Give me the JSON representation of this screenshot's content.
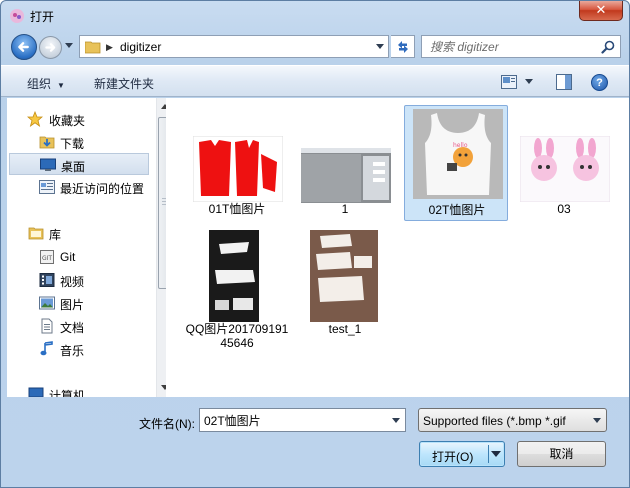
{
  "window": {
    "title": "打开",
    "close_glyph": "✕"
  },
  "nav": {
    "address_path": "digitizer",
    "address_separator": "▶",
    "search_placeholder": "搜索 digitizer"
  },
  "toolbar": {
    "organize_label": "组织",
    "new_folder_label": "新建文件夹",
    "help_glyph": "?"
  },
  "sidebar": {
    "items": [
      {
        "label": "收藏夹",
        "icon": "star-icon"
      },
      {
        "label": "下载",
        "icon": "download-folder-icon"
      },
      {
        "label": "桌面",
        "icon": "desktop-icon",
        "selected": true
      },
      {
        "label": "最近访问的位置",
        "icon": "recent-places-icon"
      },
      {
        "label": "库",
        "icon": "library-icon"
      },
      {
        "label": "Git",
        "icon": "git-library-icon"
      },
      {
        "label": "视频",
        "icon": "video-icon"
      },
      {
        "label": "图片",
        "icon": "picture-icon"
      },
      {
        "label": "文档",
        "icon": "document-icon"
      },
      {
        "label": "音乐",
        "icon": "music-icon"
      },
      {
        "label": "计算机",
        "icon": "computer-icon"
      }
    ]
  },
  "files": [
    {
      "name": "01T恤图片",
      "thumb": "red-garment-pattern"
    },
    {
      "name": "1",
      "thumb": "desktop-screenshot"
    },
    {
      "name": "02T恤图片",
      "thumb": "tank-top-print",
      "selected": true
    },
    {
      "name": "03",
      "thumb": "pink-rabbits"
    },
    {
      "name": "QQ图片20170919145646",
      "thumb": "pattern-on-black"
    },
    {
      "name": "test_1",
      "thumb": "pattern-on-brown"
    }
  ],
  "bottom": {
    "filename_label": "文件名(N):",
    "filename_value": "02T恤图片",
    "filetype_value": "Supported files (*.bmp *.gif",
    "open_label": "打开(O)",
    "cancel_label": "取消"
  }
}
